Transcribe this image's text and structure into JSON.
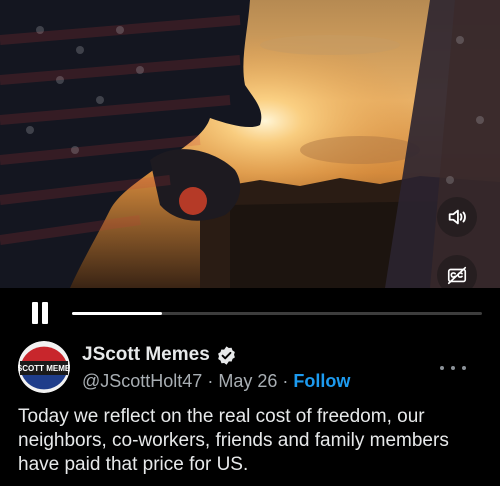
{
  "video": {
    "progress_fraction": 0.22,
    "icons": {
      "volume": "volume-icon",
      "captions": "captions-icon",
      "pause": "pause-icon"
    }
  },
  "post": {
    "avatar_text": "JSCOTT MEMES",
    "display_name": "JScott Memes",
    "handle": "@JScottHolt47",
    "separator": "·",
    "date": "May 26",
    "follow_label": "Follow",
    "text": "Today we reflect on the real cost of freedom, our neighbors, co-workers, friends and family members have paid that price for US."
  },
  "colors": {
    "accent": "#1d9bf0",
    "background": "#000000",
    "text": "#e7e9ea",
    "muted": "#a8aeb3"
  }
}
